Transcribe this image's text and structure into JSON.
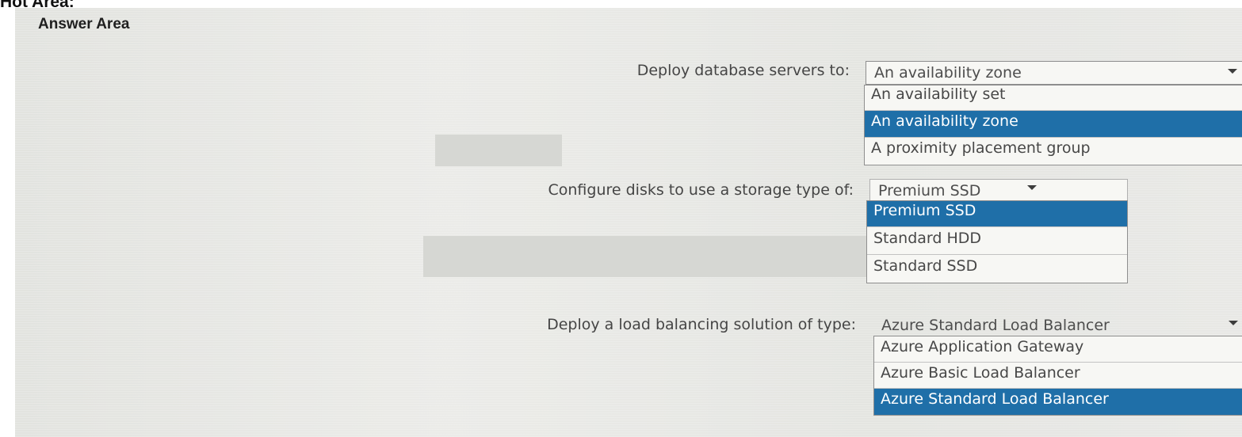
{
  "hot_area_label": "Hot Area:",
  "answer_area": {
    "title": "Answer Area",
    "questions": [
      {
        "label": "Deploy database servers to:",
        "selected": "An availability zone",
        "options": [
          "An availability set",
          "An availability zone",
          "A proximity placement group"
        ],
        "highlighted_option": "An availability zone"
      },
      {
        "label": "Configure disks to use a storage type of:",
        "selected": "Premium SSD",
        "options": [
          "Premium SSD",
          "Standard HDD",
          "Standard SSD"
        ],
        "highlighted_option": "Premium SSD"
      },
      {
        "label": "Deploy a load balancing solution of type:",
        "selected": "Azure Standard Load Balancer",
        "options": [
          "Azure Application Gateway",
          "Azure Basic Load Balancer",
          "Azure Standard Load Balancer"
        ],
        "highlighted_option": "Azure Standard Load Balancer"
      }
    ]
  },
  "colors": {
    "highlight": "#1f6fa8",
    "background": "#e9e9e7"
  }
}
